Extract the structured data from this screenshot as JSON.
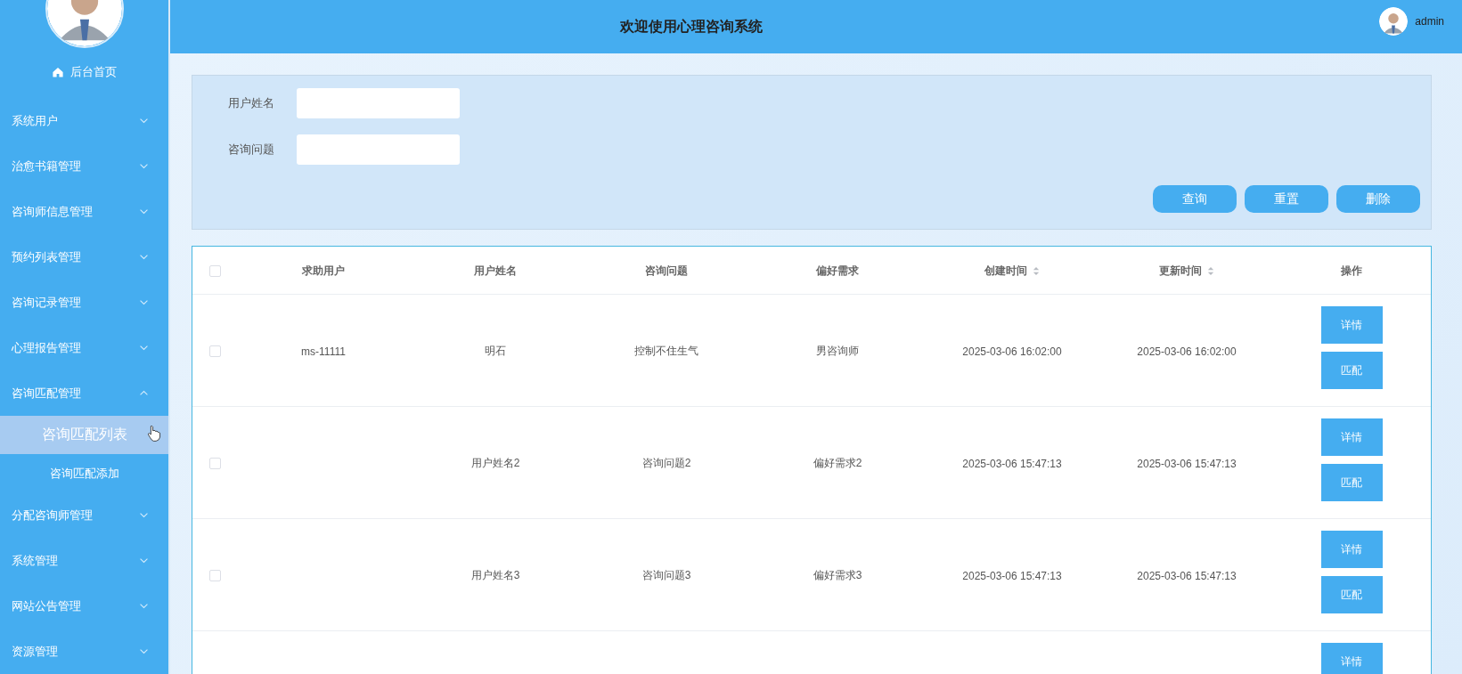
{
  "header": {
    "title": "欢迎使用心理咨询系统",
    "user": "admin"
  },
  "sidebar": {
    "home": "后台首页",
    "items": [
      {
        "label": "系统用户",
        "expanded": false
      },
      {
        "label": "治愈书籍管理",
        "expanded": false
      },
      {
        "label": "咨询师信息管理",
        "expanded": false
      },
      {
        "label": "预约列表管理",
        "expanded": false
      },
      {
        "label": "咨询记录管理",
        "expanded": false
      },
      {
        "label": "心理报告管理",
        "expanded": false
      },
      {
        "label": "咨询匹配管理",
        "expanded": true,
        "children": [
          {
            "label": "咨询匹配列表",
            "selected": true
          },
          {
            "label": "咨询匹配添加",
            "selected": false
          }
        ]
      },
      {
        "label": "分配咨询师管理",
        "expanded": false
      },
      {
        "label": "系统管理",
        "expanded": false
      },
      {
        "label": "网站公告管理",
        "expanded": false
      },
      {
        "label": "资源管理",
        "expanded": false
      }
    ]
  },
  "search": {
    "fields": [
      {
        "label": "用户姓名"
      },
      {
        "label": "咨询问题"
      }
    ],
    "buttons": [
      "查询",
      "重置",
      "删除"
    ]
  },
  "table": {
    "columns": [
      {
        "label": "求助用户",
        "sortable": false
      },
      {
        "label": "用户姓名",
        "sortable": false
      },
      {
        "label": "咨询问题",
        "sortable": false
      },
      {
        "label": "偏好需求",
        "sortable": false
      },
      {
        "label": "创建时间",
        "sortable": true
      },
      {
        "label": "更新时间",
        "sortable": true
      },
      {
        "label": "操作",
        "sortable": false
      }
    ],
    "header_checked": false,
    "rows": [
      {
        "checked": false,
        "cells": [
          "ms-11111",
          "明石",
          "控制不住生气",
          "男咨询师",
          "2025-03-06 16:02:00",
          "2025-03-06 16:02:00"
        ],
        "actions": [
          "详情",
          "匹配"
        ]
      },
      {
        "checked": false,
        "cells": [
          null,
          "用户姓名2",
          "咨询问题2",
          "偏好需求2",
          "2025-03-06 15:47:13",
          "2025-03-06 15:47:13"
        ],
        "actions": [
          "详情",
          "匹配"
        ]
      },
      {
        "checked": false,
        "cells": [
          null,
          "用户姓名3",
          "咨询问题3",
          "偏好需求3",
          "2025-03-06 15:47:13",
          "2025-03-06 15:47:13"
        ],
        "actions": [
          "详情",
          "匹配"
        ]
      },
      {
        "actions": [
          "详情"
        ]
      }
    ]
  }
}
